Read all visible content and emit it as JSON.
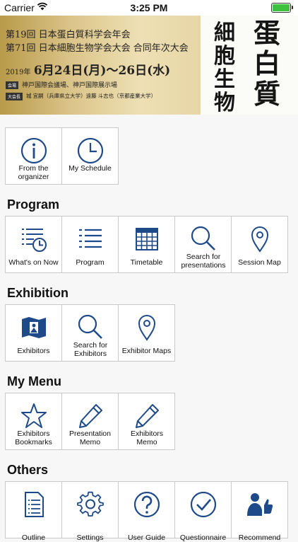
{
  "status": {
    "carrier": "Carrier",
    "time": "3:25 PM"
  },
  "banner": {
    "line1": "第19回 日本蛋白質科学会年会",
    "line2": "第71回 日本細胞生物学会大会 合同年次大会",
    "date_year": "2019年",
    "date_main": "6月24日(月)～26日(水)",
    "venue_tag": "会場",
    "venue": "神戸国際会議場、神戸国際展示場",
    "chair_tag": "大会長",
    "chairs": "城 宜嗣（兵庫県立大学）遠藤 斗志也（京都産業大学）",
    "calligraphy_right": [
      "蛋",
      "白",
      "質"
    ],
    "calligraphy_left": [
      "細",
      "胞",
      "生",
      "物"
    ]
  },
  "top_tiles": [
    {
      "label": "From the organizer",
      "icon": "info-icon"
    },
    {
      "label": "My Schedule",
      "icon": "clock-icon"
    }
  ],
  "sections": {
    "program": {
      "title": "Program",
      "tiles": [
        {
          "label": "What's on Now",
          "icon": "list-clock-icon"
        },
        {
          "label": "Program",
          "icon": "list-icon"
        },
        {
          "label": "Timetable",
          "icon": "calendar-grid-icon"
        },
        {
          "label": "Search for presentations",
          "icon": "search-icon"
        },
        {
          "label": "Session Map",
          "icon": "map-pin-icon"
        }
      ]
    },
    "exhibition": {
      "title": "Exhibition",
      "tiles": [
        {
          "label": "Exhibitors",
          "icon": "exhibitor-map-icon"
        },
        {
          "label": "Search for Exhibitors",
          "icon": "search-icon"
        },
        {
          "label": "Exhibitor Maps",
          "icon": "map-pin-icon"
        }
      ]
    },
    "mymenu": {
      "title": "My Menu",
      "tiles": [
        {
          "label": "Exhibitors Bookmarks",
          "icon": "star-icon"
        },
        {
          "label": "Presentation Memo",
          "icon": "pencil-icon"
        },
        {
          "label": "Exhibitors Memo",
          "icon": "pencil-icon"
        }
      ]
    },
    "others": {
      "title": "Others",
      "tiles": [
        {
          "label": "Outline",
          "icon": "document-icon"
        },
        {
          "label": "Settings",
          "icon": "gear-icon"
        },
        {
          "label": "User Guide",
          "icon": "help-icon"
        },
        {
          "label": "Questionnaire",
          "icon": "check-circle-icon"
        },
        {
          "label": "Recommend",
          "icon": "thumbs-up-person-icon"
        }
      ]
    }
  },
  "colors": {
    "icon": "#1f4a8a",
    "accent_red": "#c62828",
    "battery": "#3ec23e"
  }
}
